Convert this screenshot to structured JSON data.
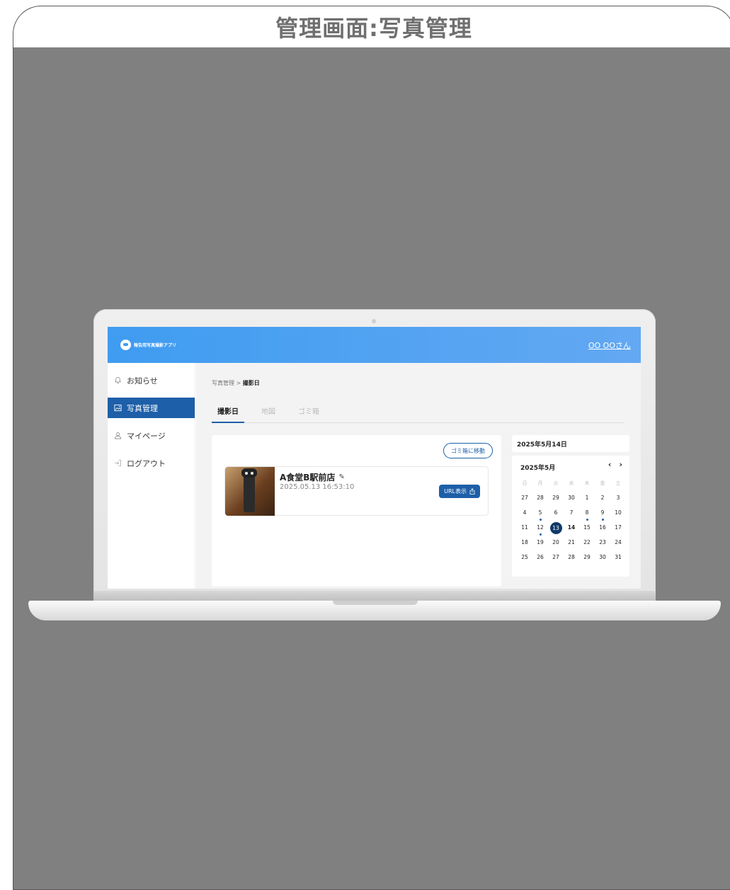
{
  "frame_title": "管理画面:写真管理",
  "app": {
    "brand": "報告用写真撮影アプリ",
    "user": "OO OOさん"
  },
  "sidebar": {
    "items": [
      {
        "label": "お知らせ",
        "icon": "bell-icon",
        "active": false
      },
      {
        "label": "写真管理",
        "icon": "image-icon",
        "active": true
      },
      {
        "label": "マイページ",
        "icon": "user-icon",
        "active": false
      },
      {
        "label": "ログアウト",
        "icon": "logout-icon",
        "active": false
      }
    ]
  },
  "breadcrumb": {
    "parent": "写真管理",
    "separator": ">",
    "current": "撮影日"
  },
  "tabs": [
    {
      "label": "撮影日",
      "active": true
    },
    {
      "label": "地図",
      "active": false
    },
    {
      "label": "ゴミ箱",
      "active": false
    }
  ],
  "photo_panel": {
    "trash_button": "ゴミ箱に移動",
    "item": {
      "title": "A食堂B駅前店",
      "timestamp": "2025.05.13 16:53:10",
      "url_button": "URL表示"
    }
  },
  "calendar": {
    "selected_date_label": "2025年5月14日",
    "month_label": "2025年5月",
    "weekdays": [
      "日",
      "月",
      "火",
      "水",
      "木",
      "金",
      "土"
    ],
    "weeks": [
      [
        "27",
        "28",
        "29",
        "30",
        "1",
        "2",
        "3"
      ],
      [
        "4",
        "5",
        "6",
        "7",
        "8",
        "9",
        "10"
      ],
      [
        "11",
        "12",
        "13",
        "14",
        "15",
        "16",
        "17"
      ],
      [
        "18",
        "19",
        "20",
        "21",
        "22",
        "23",
        "24"
      ],
      [
        "25",
        "26",
        "27",
        "28",
        "29",
        "30",
        "31"
      ]
    ],
    "days_with_photos": [
      "5",
      "8",
      "9",
      "12"
    ],
    "selected_day": "13",
    "today": "14"
  },
  "colors": {
    "accent": "#1d5fa8",
    "topbar": "#3f9cf1",
    "selected_day": "#103a6b"
  }
}
